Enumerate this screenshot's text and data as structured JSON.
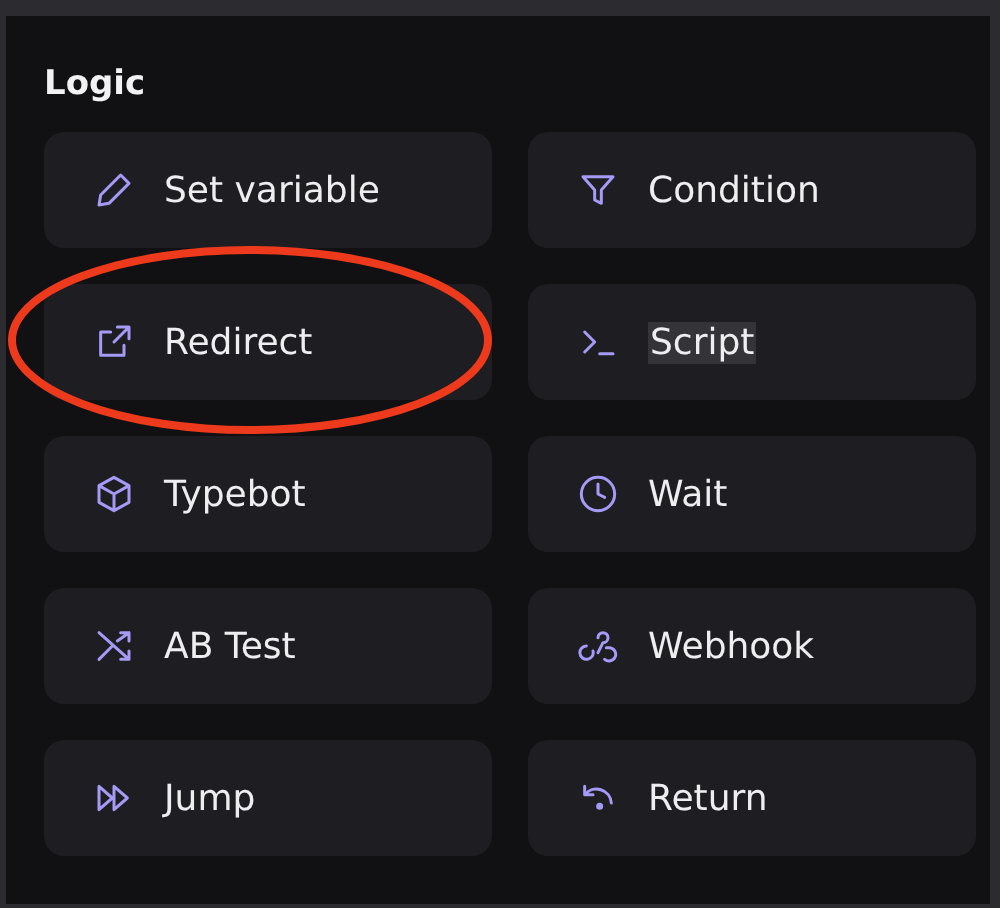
{
  "section": {
    "title": "Logic"
  },
  "blocks": [
    {
      "label": "Set variable",
      "circled": false,
      "highlighted": false
    },
    {
      "label": "Condition",
      "circled": false,
      "highlighted": false
    },
    {
      "label": "Redirect",
      "circled": true,
      "highlighted": false
    },
    {
      "label": "Script",
      "circled": false,
      "highlighted": true
    },
    {
      "label": "Typebot",
      "circled": false,
      "highlighted": false
    },
    {
      "label": "Wait",
      "circled": false,
      "highlighted": false
    },
    {
      "label": "AB Test",
      "circled": false,
      "highlighted": false
    },
    {
      "label": "Webhook",
      "circled": false,
      "highlighted": false
    },
    {
      "label": "Jump",
      "circled": false,
      "highlighted": false
    },
    {
      "label": "Return",
      "circled": false,
      "highlighted": false
    }
  ]
}
